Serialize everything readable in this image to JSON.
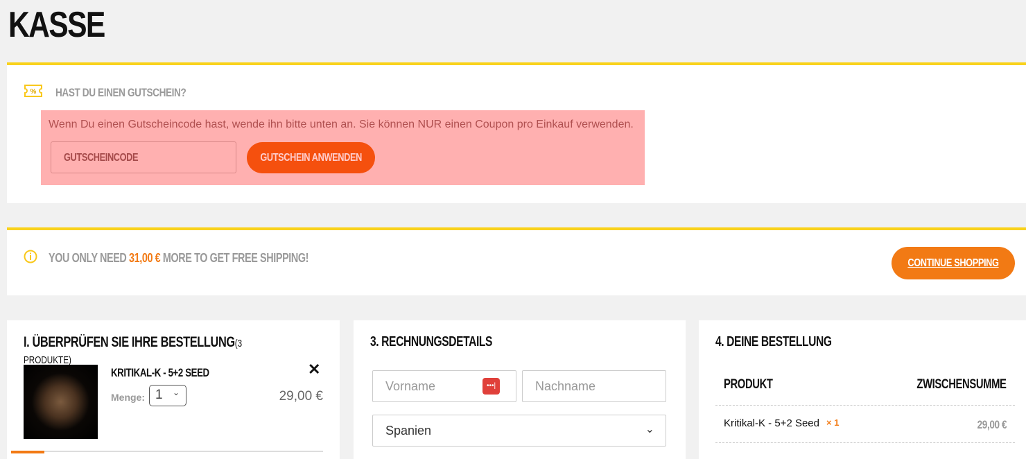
{
  "page_title": "KASSE",
  "coupon": {
    "title": "HAST DU EINEN GUTSCHEIN?",
    "notice": "Wenn Du einen Gutscheincode hast, wende ihn bitte unten an. Sie können NUR einen Coupon pro Einkauf verwenden.",
    "placeholder": "GUTSCHEINCODE",
    "apply_label": "GUTSCHEIN ANWENDEN"
  },
  "shipping": {
    "prefix": "YOU ONLY NEED",
    "amount": "31,00 €",
    "suffix": "MORE TO GET FREE SHIPPING!",
    "continue_label": "CONTINUE SHOPPING"
  },
  "review": {
    "title": "I. ÜBERPRÜFEN SIE IHRE BESTELLUNG",
    "count": "(3 PRODUKTE)",
    "item": {
      "name": "KRITIKAL-K - 5+2 SEED",
      "qty_label": "Menge:",
      "qty": "1",
      "price": "29,00 €"
    }
  },
  "billing": {
    "title": "3. RECHNUNGSDETAILS",
    "first_name_placeholder": "Vorname",
    "last_name_placeholder": "Nachname",
    "country": "Spanien"
  },
  "order": {
    "title": "4. DEINE BESTELLUNG",
    "col_product": "PRODUKT",
    "col_subtotal": "ZWISCHENSUMME",
    "rows": [
      {
        "name": "Kritikal-K - 5+2 Seed",
        "qty": "× 1",
        "subtotal": "29,00 €"
      }
    ]
  },
  "colors": {
    "accent": "#f27a14",
    "coupon_button": "#f5500e",
    "yellow": "#f9d21c",
    "notice_bg": "#ffb0b0"
  }
}
